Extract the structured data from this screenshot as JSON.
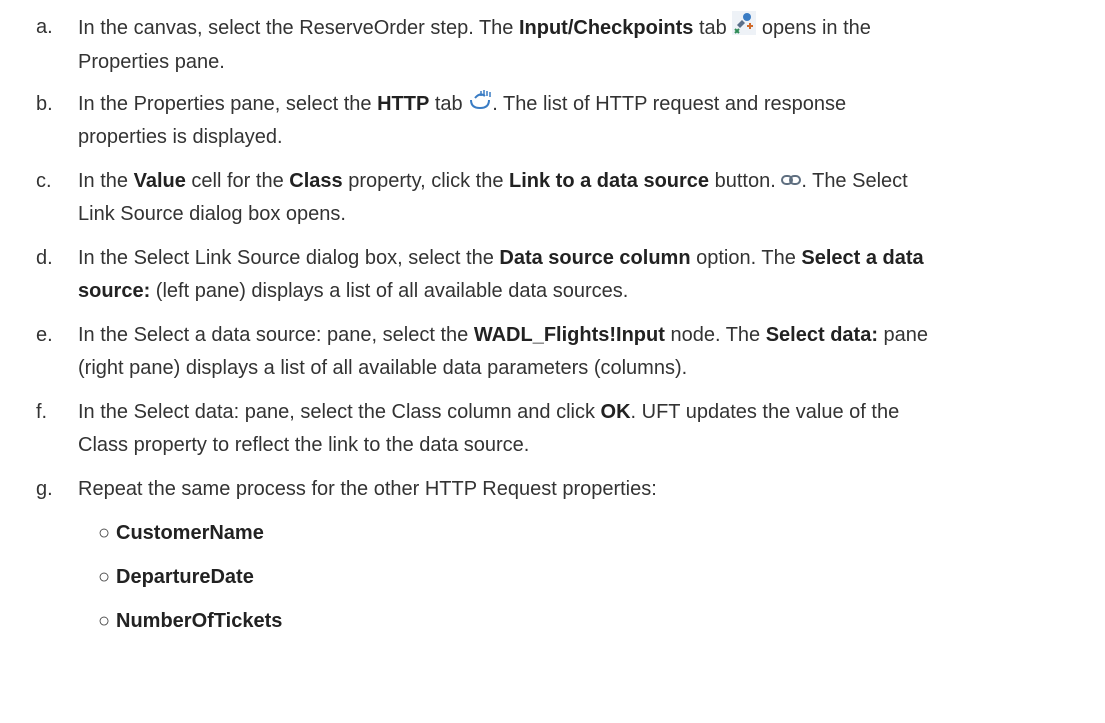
{
  "steps": {
    "a": {
      "letter": "a.",
      "t1": "In the canvas, select the ReserveOrder step. The ",
      "b1": "Input/Checkpoints",
      "t2": " tab ",
      "t3": " opens in the",
      "t4": "Properties pane."
    },
    "b": {
      "letter": "b.",
      "t1": "In the Properties pane, select the ",
      "b1": "HTTP",
      "t2": " tab ",
      "t3": ". The list of HTTP request and response",
      "t4": "properties is displayed."
    },
    "c": {
      "letter": "c.",
      "t1": "In the ",
      "b1": "Value",
      "t2": " cell for the ",
      "b2": "Class",
      "t3": " property, click the ",
      "b3": "Link to a data source",
      "t4": " button. ",
      "t5": ". The Select",
      "t6": "Link Source dialog box opens."
    },
    "d": {
      "letter": "d.",
      "t1": "In the Select Link Source dialog box, select the ",
      "b1": "Data source column",
      "t2": " option. The ",
      "b2": "Select a data",
      "b3": "source:",
      "t3": " (left pane) displays a list of all available data sources."
    },
    "e": {
      "letter": "e.",
      "t1": "In the Select a data source: pane, select the ",
      "b1": "WADL_Flights!Input",
      "t2": " node. The ",
      "b2": "Select data:",
      "t3": " pane",
      "t4": "(right pane) displays a list of all available data parameters (columns)."
    },
    "f": {
      "letter": "f.",
      "t1": "In the Select data: pane, select the Class column and click ",
      "b1": "OK",
      "t2": ". UFT updates the value of the",
      "t3": "Class property to reflect the link to the data source."
    },
    "g": {
      "letter": "g.",
      "t1": "Repeat the same process for the other HTTP Request properties:"
    }
  },
  "sub_items": [
    "CustomerName",
    "DepartureDate",
    "NumberOfTickets"
  ],
  "bullet": "○",
  "icons": {
    "input_checkpoints": "input-checkpoints-icon",
    "http": "http-icon",
    "link": "link-chain-icon"
  }
}
